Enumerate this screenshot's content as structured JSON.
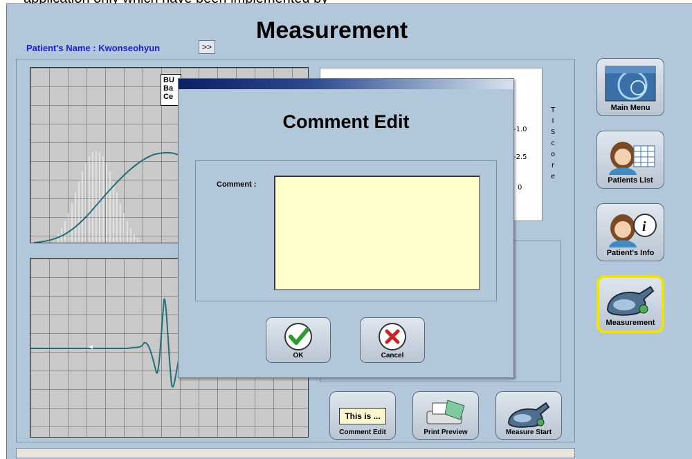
{
  "top_text": "application only which have been implemented by",
  "window": {
    "title": "Measurement",
    "patient_label": "Patient's Name : Kwonseohyun",
    "more_button": ">>"
  },
  "chart": {
    "legend_lines": [
      "BU",
      "Ba",
      "Ce"
    ],
    "score_ticks": [
      "-1.0",
      "-2.5",
      "0"
    ],
    "tscore_letters": [
      "T",
      "I",
      "S",
      "c",
      "o",
      "r",
      "e"
    ]
  },
  "nav": [
    {
      "label": "Main Menu",
      "icon": "main-menu-icon"
    },
    {
      "label": "Patients List",
      "icon": "patients-list-icon"
    },
    {
      "label": "Patient's Info",
      "icon": "patient-info-icon"
    },
    {
      "label": "Measurement",
      "icon": "measurement-device-icon",
      "active": true
    }
  ],
  "toolbar": {
    "comment_preview": "This is ...",
    "comment_edit_label": "Comment Edit",
    "print_preview_label": "Print Preview",
    "measure_start_label": "Measure Start"
  },
  "dialog": {
    "title": "Comment Edit",
    "comment_label": "Comment :",
    "comment_value": "",
    "ok_label": "OK",
    "cancel_label": "Cancel"
  },
  "colors": {
    "app_background": "#b3c7da",
    "patient_text": "#1b1bd8",
    "active_border": "#f2e400",
    "curve": "#1e6f7a",
    "comment_background": "#ffffcc"
  }
}
